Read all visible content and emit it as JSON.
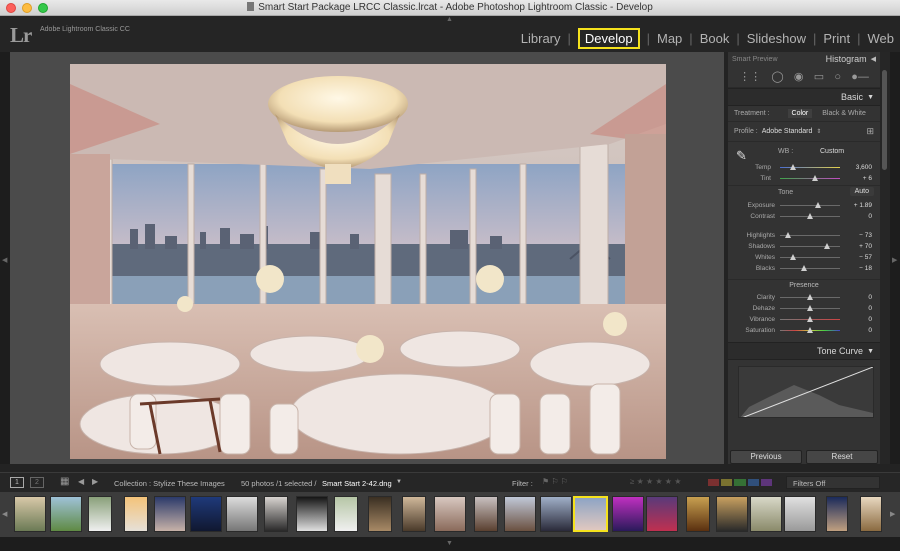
{
  "window": {
    "title": "Smart Start Package LRCC Classic.lrcat - Adobe Photoshop Lightroom Classic - Develop",
    "product_name": "Adobe Lightroom Classic CC",
    "logo": "Lr"
  },
  "modules": [
    "Library",
    "Develop",
    "Map",
    "Book",
    "Slideshow",
    "Print",
    "Web"
  ],
  "active_module": "Develop",
  "right_panel": {
    "smart_preview": "Smart Preview",
    "histogram": "Histogram",
    "basic": "Basic",
    "treatment_label": "Treatment :",
    "treatment_color": "Color",
    "treatment_bw": "Black & White",
    "profile_label": "Profile :",
    "profile_value": "Adobe Standard",
    "wb_label": "WB :",
    "wb_value": "Custom",
    "temp_label": "Temp",
    "temp_value": "3,600",
    "tint_label": "Tint",
    "tint_value": "+ 6",
    "tone_label": "Tone",
    "auto_label": "Auto",
    "exposure_label": "Exposure",
    "exposure_value": "+ 1.89",
    "contrast_label": "Contrast",
    "contrast_value": "0",
    "highlights_label": "Highlights",
    "highlights_value": "− 73",
    "shadows_label": "Shadows",
    "shadows_value": "+ 70",
    "whites_label": "Whites",
    "whites_value": "− 57",
    "blacks_label": "Blacks",
    "blacks_value": "− 18",
    "presence_label": "Presence",
    "clarity_label": "Clarity",
    "clarity_value": "0",
    "dehaze_label": "Dehaze",
    "dehaze_value": "0",
    "vibrance_label": "Vibrance",
    "vibrance_value": "0",
    "saturation_label": "Saturation",
    "saturation_value": "0",
    "tone_curve": "Tone Curve",
    "previous_label": "Previous",
    "reset_label": "Reset"
  },
  "filmstrip_bar": {
    "page1": "1",
    "page2": "2",
    "collection": "Collection : Stylize These Images",
    "count": "50 photos /1 selected /",
    "selected_file": "Smart Start 2-42.dng",
    "filter_label": "Filter :",
    "filters_off": "Filters Off"
  },
  "colors": {
    "accent_highlight": "#f5e21d",
    "temp_track": "blue-to-yellow",
    "tint_track": "green-to-magenta"
  }
}
